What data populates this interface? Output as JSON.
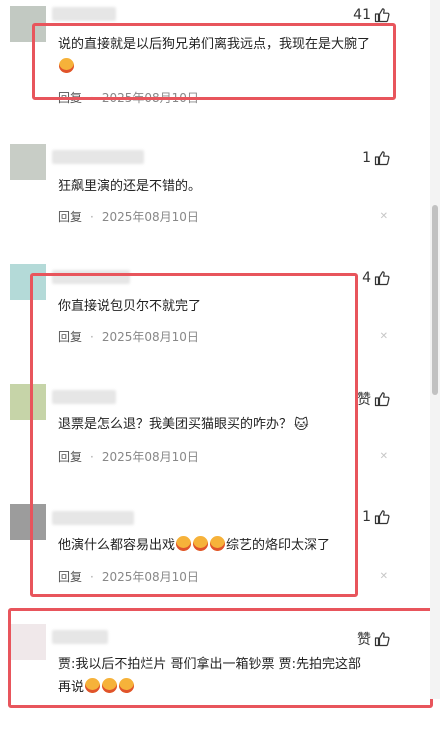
{
  "colors": {
    "highlight": "#e8555c",
    "meta_text": "#888888",
    "emoji": "#f6b23a"
  },
  "icons": {
    "like": "thumbs-up-icon",
    "close": "close-icon",
    "emoji": "laughing-emoji-icon"
  },
  "comments": [
    {
      "avatar_color": "#c2c9c2",
      "likes": "41",
      "like_label": "",
      "text": "说的直接就是以后狗兄弟们离我远点，我现在是大腕了",
      "emoji_count": 1,
      "reply": "回复",
      "date": "2025年08月10日"
    },
    {
      "avatar_color": "#c8cdc6",
      "likes": "1",
      "like_label": "",
      "text": "狂飙里演的还是不错的。",
      "emoji_count": 0,
      "reply": "回复",
      "date": "2025年08月10日"
    },
    {
      "avatar_color": "#b4dad8",
      "likes": "4",
      "like_label": "",
      "text": "你直接说包贝尔不就完了",
      "emoji_count": 0,
      "reply": "回复",
      "date": "2025年08月10日"
    },
    {
      "avatar_color": "#c6d4a8",
      "likes": "",
      "like_label": "赞",
      "text": "退票是怎么退？我美团买猫眼买的咋办？",
      "emoji_count": 0,
      "reply": "回复",
      "date": "2025年08月10日"
    },
    {
      "avatar_color": "#9c9c9c",
      "likes": "1",
      "like_label": "",
      "text": "他演什么都容易出戏",
      "text_suffix": "综艺的烙印太深了",
      "emoji_count": 3,
      "reply": "回复",
      "date": "2025年08月10日"
    },
    {
      "avatar_color": "#f0e8ea",
      "likes": "",
      "like_label": "赞",
      "text": "贾:我以后不拍烂片 哥们拿出一箱钞票 贾:先拍完这部再说",
      "emoji_count": 3,
      "reply": "",
      "date": ""
    }
  ]
}
